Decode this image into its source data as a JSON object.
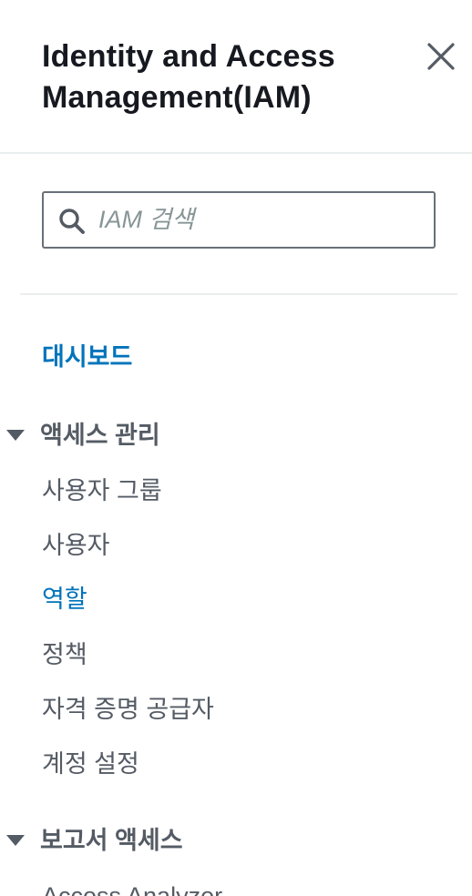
{
  "header": {
    "title": "Identity and Access Management(IAM)",
    "close_icon": "close-icon"
  },
  "search": {
    "placeholder": "IAM 검색",
    "value": "",
    "icon": "search-icon"
  },
  "nav": {
    "dashboard": "대시보드",
    "sections": [
      {
        "label": "액세스 관리",
        "expanded": true,
        "items": [
          {
            "label": "사용자 그룹",
            "active": false
          },
          {
            "label": "사용자",
            "active": false
          },
          {
            "label": "역할",
            "active": true
          },
          {
            "label": "정책",
            "active": false
          },
          {
            "label": "자격 증명 공급자",
            "active": false
          },
          {
            "label": "계정 설정",
            "active": false
          }
        ]
      },
      {
        "label": "보고서 액세스",
        "expanded": true,
        "items": [
          {
            "label": "Access Analyzer",
            "active": false
          }
        ]
      }
    ]
  },
  "colors": {
    "link_active": "#0073bb",
    "text_primary": "#16191f",
    "text_secondary": "#545b64",
    "border": "#687078",
    "divider": "#eaeded"
  }
}
